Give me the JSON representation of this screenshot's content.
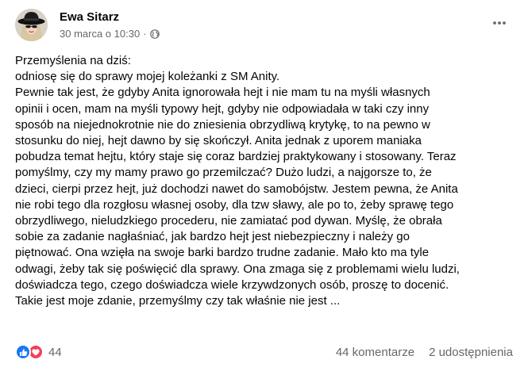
{
  "post": {
    "author": "Ewa Sitarz",
    "date": "30 marca o 10:30",
    "separator": "·",
    "privacy_icon": "globe-icon",
    "more_icon": "more-horizontal-icon",
    "text_lines": [
      "Przemyślenia na dziś:",
      "odniosę się do sprawy mojej koleżanki z SM Anity.",
      "Pewnie tak jest, że gdyby Anita ignorowała hejt i nie mam tu na myśli własnych",
      "opinii i ocen, mam na myśli typowy hejt, gdyby nie odpowiadała w taki czy inny",
      "sposób na niejednokrotnie nie do zniesienia obrzydliwą krytykę, to na pewno w",
      "stosunku do niej, hejt dawno by się skończył. Anita jednak z uporem maniaka",
      "pobudza temat hejtu, który staje się coraz bardziej praktykowany i stosowany. Teraz",
      "pomyślmy, czy my mamy prawo go przemilczać? Dużo ludzi, a najgorsze to, że",
      "dzieci, cierpi przez hejt, już dochodzi nawet do samobójstw. Jestem pewna, że Anita",
      "nie robi tego dla rozgłosu własnej osoby, dla tzw sławy, ale po to, żeby sprawę tego",
      "obrzydliwego, nieludzkiego procederu, nie zamiatać pod dywan. Myślę, że obrała",
      "sobie za zadanie nagłaśniać, jak bardzo hejt jest niebezpieczny i należy go",
      "piętnować. Ona wzięła na swoje barki bardzo trudne zadanie. Mało kto ma tyle",
      "odwagi, żeby tak się poświęcić dla sprawy. Ona zmaga się z problemami wielu ludzi,",
      "doświadcza tego, czego doświadcza wiele krzywdzonych osób, proszę to docenić.",
      "Takie jest moje zdanie, przemyślmy czy tak właśnie nie jest ..."
    ]
  },
  "footer": {
    "reaction_icons": [
      "like-icon",
      "love-icon"
    ],
    "reactions_count": "44",
    "comments": "44 komentarze",
    "shares": "2 udostępnienia"
  },
  "colors": {
    "text": "#050505",
    "secondary_text": "#65676b",
    "like_blue": "#1877f2",
    "love_red": "#f33e58"
  }
}
